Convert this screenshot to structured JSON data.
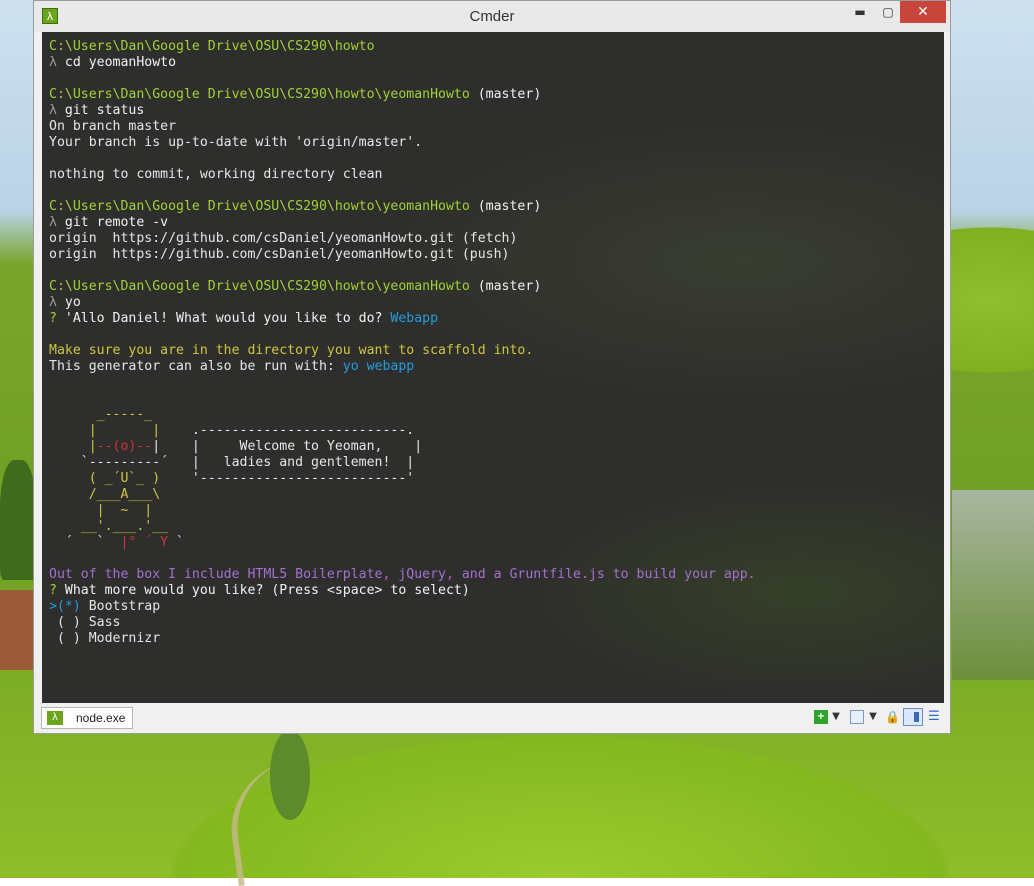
{
  "window": {
    "title": "Cmder",
    "app_icon": "λ",
    "controls": {
      "minimize": "▬",
      "maximize": "▢",
      "close": "✕"
    }
  },
  "terminal": {
    "l01": "C:\\Users\\Dan\\Google Drive\\OSU\\CS290\\howto",
    "l02_prompt": "λ",
    "l02_cmd": " cd yeomanHowto",
    "l04_path": "C:\\Users\\Dan\\Google Drive\\OSU\\CS290\\howto\\yeomanHowto",
    "l04_branch": " (master)",
    "l05_prompt": "λ",
    "l05_cmd": " git status",
    "l06": "On branch master",
    "l07": "Your branch is up-to-date with 'origin/master'.",
    "l09": "nothing to commit, working directory clean",
    "l11_path": "C:\\Users\\Dan\\Google Drive\\OSU\\CS290\\howto\\yeomanHowto",
    "l11_branch": " (master)",
    "l12_prompt": "λ",
    "l12_cmd": " git remote -v",
    "l13": "origin  https://github.com/csDaniel/yeomanHowto.git (fetch)",
    "l14": "origin  https://github.com/csDaniel/yeomanHowto.git (push)",
    "l16_path": "C:\\Users\\Dan\\Google Drive\\OSU\\CS290\\howto\\yeomanHowto",
    "l16_branch": " (master)",
    "l17_prompt": "λ",
    "l17_cmd": " yo",
    "l18_q": "?",
    "l18_text": " 'Allo Daniel! What would you like to do? ",
    "l18_answer": "Webapp",
    "l20": "Make sure you are in the directory you want to scaffold into.",
    "l21_text": "This generator can also be run with: ",
    "l21_cmd": "yo webapp",
    "art": {
      "a1": "      _-----_",
      "a2a": "     |       |    ",
      "a2b": ".--------------------------.",
      "a3a": "     |",
      "a3b": "--(o)--",
      "a3c": "|    |     Welcome to Yeoman,    |",
      "a4a": "    `---------´   |   ladies and gentlemen!  |",
      "a5a": "     ( _´U`_ )    ",
      "a5b": "'--------------------------'",
      "a6": "     /___A___\\",
      "a7": "      |  ~  |",
      "a8": "    __'.___.'__",
      "a9a": "  ´   `  ",
      "a9b": "|° ´ Y",
      "a9c": " `"
    },
    "l31": "Out of the box I include HTML5 Boilerplate, jQuery, and a Gruntfile.js to build your app.",
    "l32_q": "?",
    "l32_text": " What more would you like? (Press <space> to select)",
    "options": [
      {
        "cursor": ">",
        "mark": "(*)",
        "label": " Bootstrap"
      },
      {
        "cursor": " ",
        "mark": "( )",
        "label": " Sass"
      },
      {
        "cursor": " ",
        "mark": "( )",
        "label": " Modernizr"
      }
    ]
  },
  "tabbar": {
    "tab_icon": "λ",
    "tab_label": "node.exe",
    "new_console": "+",
    "dropdown_arrow": "▼",
    "lock": "🔒",
    "menu": "☰"
  }
}
